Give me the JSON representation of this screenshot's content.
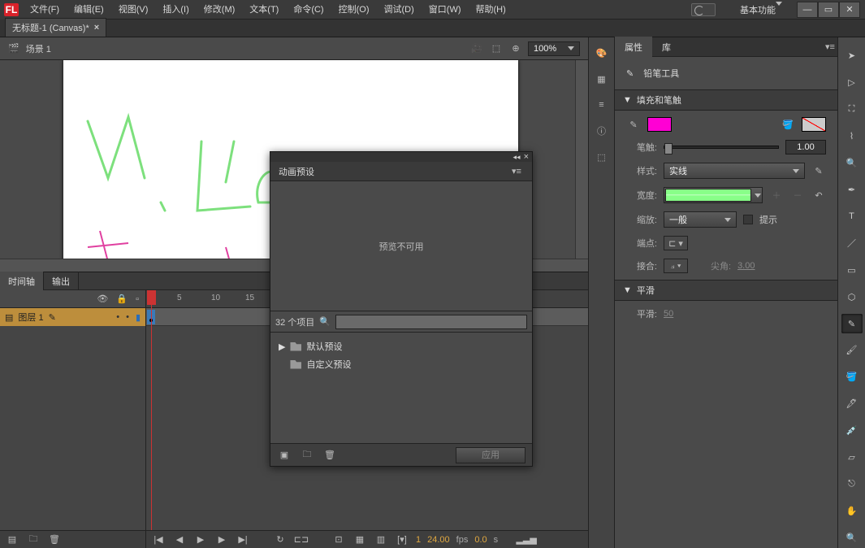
{
  "menu": {
    "items": [
      "文件(F)",
      "编辑(E)",
      "视图(V)",
      "插入(I)",
      "修改(M)",
      "文本(T)",
      "命令(C)",
      "控制(O)",
      "调试(D)",
      "窗口(W)",
      "帮助(H)"
    ]
  },
  "workspace": {
    "label": "基本功能"
  },
  "docTab": {
    "title": "无标题-1 (Canvas)*"
  },
  "stage": {
    "sceneLabel": "场景 1",
    "zoom": "100%"
  },
  "timeline": {
    "tab1": "时间轴",
    "tab2": "输出",
    "layerName": "图层 1",
    "rulerMarks": [
      "1",
      "5",
      "10",
      "15"
    ],
    "frame": "1",
    "fps": "24.00",
    "fpsUnit": "fps",
    "time": "0.0",
    "timeUnit": "s"
  },
  "floatPanel": {
    "title": "动画预设",
    "previewMsg": "预览不可用",
    "count": "32 个项目",
    "tree1": "默认预设",
    "tree2": "自定义预设",
    "applyLabel": "应用"
  },
  "propPanel": {
    "tab1": "属性",
    "tab2": "库",
    "toolName": "铅笔工具",
    "sec1": "填充和笔触",
    "strokeLabel": "笔触:",
    "strokeVal": "1.00",
    "styleLabel": "样式:",
    "styleVal": "实线",
    "widthLabel": "宽度:",
    "scaleLabel": "缩放:",
    "scaleVal": "一般",
    "hintLabel": "提示",
    "capLabel": "端点:",
    "joinLabel": "接合:",
    "miterLabel": "尖角:",
    "miterVal": "3.00",
    "sec2": "平滑",
    "smoothLabel": "平滑:",
    "smoothVal": "50"
  },
  "colors": {
    "fill": "#ff00d4"
  }
}
